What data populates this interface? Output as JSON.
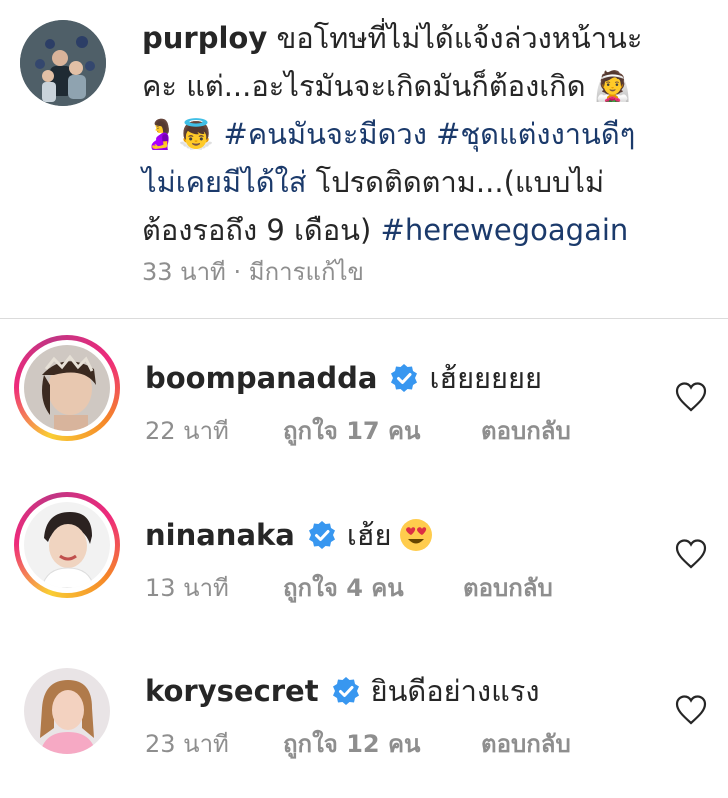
{
  "caption": {
    "username": "purploy",
    "line1": "ขอโทษที่ไม่ได้แจ้งล่วงหน้านะ",
    "line2": "คะ แต่...อะไรมันจะเกิดมันก็ต้องเกิด",
    "emojis_a": "👰",
    "emojis_b": "🤰👼",
    "hashtag1": "#คนมันจะมีดวง",
    "hashtag2": "#ชุดแต่งงานดีๆ",
    "hashtag2b": "ไม่เคยมีได้ใส่",
    "line4": "โปรดติดตาม...(แบบไม่",
    "line5": "ต้องรอถึง 9 เดือน)",
    "hashtag3": "#herewegoagain",
    "meta": "33 นาที · มีการแก้ไข"
  },
  "comments": [
    {
      "username": "boompanadda",
      "text": "เฮ้ยยยยย",
      "time": "22 นาที",
      "likes": "ถูกใจ 17 คน",
      "reply": "ตอบกลับ",
      "has_story_ring": true
    },
    {
      "username": "ninanaka",
      "text": "เฮ้ย",
      "emoji": "😍",
      "time": "13 นาที",
      "likes": "ถูกใจ 4 คน",
      "reply": "ตอบกลับ",
      "has_story_ring": true
    },
    {
      "username": "korysecret",
      "text": "ยินดีอย่างแรง",
      "time": "23 นาที",
      "likes": "ถูกใจ 12 คน",
      "reply": "ตอบกลับ",
      "has_story_ring": false
    }
  ],
  "icons": {
    "verified": "verified-badge-icon",
    "heart": "heart-outline-icon"
  },
  "colors": {
    "verified_blue": "#3897f0",
    "hashtag": "#1b3a6b",
    "meta_gray": "#8e8e8e",
    "text": "#262626"
  }
}
